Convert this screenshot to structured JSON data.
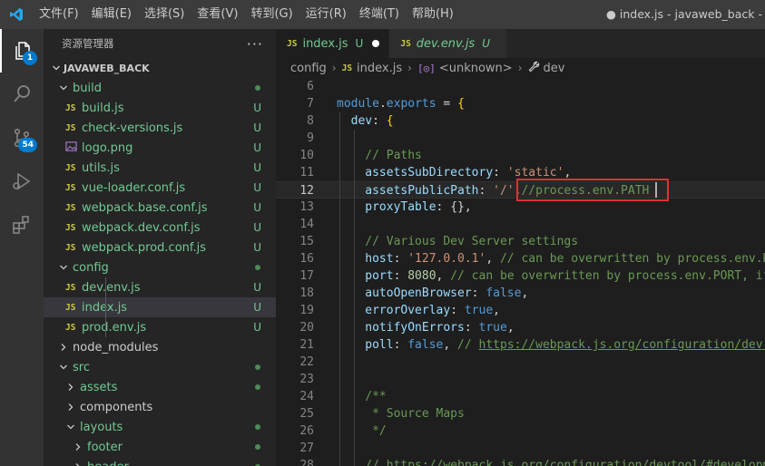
{
  "app": {
    "window_title": "● index.js - javaweb_back - Visual",
    "menu": [
      "文件(F)",
      "编辑(E)",
      "选择(S)",
      "查看(V)",
      "转到(G)",
      "运行(R)",
      "终端(T)",
      "帮助(H)"
    ]
  },
  "activity_bar": {
    "explorer_badge": "1",
    "scm_badge": "54"
  },
  "sidebar": {
    "title": "资源管理器",
    "more": "···",
    "root": "JAVAWEB_BACK",
    "tree": [
      {
        "label": "build",
        "type": "folder",
        "open": true,
        "depth": 1,
        "status": "dot"
      },
      {
        "label": "build.js",
        "type": "js",
        "depth": 2,
        "status": "U"
      },
      {
        "label": "check-versions.js",
        "type": "js",
        "depth": 2,
        "status": "U"
      },
      {
        "label": "logo.png",
        "type": "img",
        "depth": 2,
        "status": "U"
      },
      {
        "label": "utils.js",
        "type": "js",
        "depth": 2,
        "status": "U"
      },
      {
        "label": "vue-loader.conf.js",
        "type": "js",
        "depth": 2,
        "status": "U"
      },
      {
        "label": "webpack.base.conf.js",
        "type": "js",
        "depth": 2,
        "status": "U"
      },
      {
        "label": "webpack.dev.conf.js",
        "type": "js",
        "depth": 2,
        "status": "U"
      },
      {
        "label": "webpack.prod.conf.js",
        "type": "js",
        "depth": 2,
        "status": "U"
      },
      {
        "label": "config",
        "type": "folder",
        "open": true,
        "depth": 1,
        "status": "dot"
      },
      {
        "label": "dev.env.js",
        "type": "js",
        "depth": 2,
        "status": "U",
        "guide": true
      },
      {
        "label": "index.js",
        "type": "js",
        "depth": 2,
        "status": "U",
        "selected": true,
        "guide": true
      },
      {
        "label": "prod.env.js",
        "type": "js",
        "depth": 2,
        "status": "U",
        "guide": true
      },
      {
        "label": "node_modules",
        "type": "folder",
        "open": false,
        "depth": 1,
        "status": "",
        "plain": true
      },
      {
        "label": "src",
        "type": "folder",
        "open": true,
        "depth": 1,
        "status": "dot"
      },
      {
        "label": "assets",
        "type": "folder",
        "open": false,
        "depth": 2,
        "status": "dot"
      },
      {
        "label": "components",
        "type": "folder",
        "open": false,
        "depth": 2,
        "status": "",
        "plain": true
      },
      {
        "label": "layouts",
        "type": "folder",
        "open": true,
        "depth": 2,
        "status": "dot"
      },
      {
        "label": "footer",
        "type": "folder",
        "open": false,
        "depth": 3,
        "status": "dot"
      },
      {
        "label": "header",
        "type": "folder",
        "open": false,
        "depth": 3,
        "status": "dot"
      }
    ]
  },
  "tabs": [
    {
      "icon": "JS",
      "label": "index.js",
      "flag": "U",
      "modified": true,
      "active": true,
      "italic": false
    },
    {
      "icon": "JS",
      "label": "dev.env.js",
      "flag": "U",
      "modified": false,
      "active": false,
      "italic": true
    }
  ],
  "breadcrumb": {
    "folder": "config",
    "file": "index.js",
    "symbol1": "<unknown>",
    "symbol2": "dev",
    "file_icon": "JS"
  },
  "code": {
    "current_line": 12,
    "lines": [
      {
        "n": "6",
        "indent": 0,
        "tokens": []
      },
      {
        "n": "7",
        "indent": 0,
        "tokens": [
          [
            "kw",
            "module"
          ],
          [
            "p",
            "."
          ],
          [
            "kw",
            "exports"
          ],
          [
            "p",
            " = "
          ],
          [
            "b",
            "{"
          ]
        ]
      },
      {
        "n": "8",
        "indent": 1,
        "tokens": [
          [
            "k",
            "dev"
          ],
          [
            "p",
            ": "
          ],
          [
            "b",
            "{"
          ]
        ]
      },
      {
        "n": "9",
        "indent": 0,
        "tokens": []
      },
      {
        "n": "10",
        "indent": 2,
        "tokens": [
          [
            "c",
            "// Paths"
          ]
        ]
      },
      {
        "n": "11",
        "indent": 2,
        "tokens": [
          [
            "k",
            "assetsSubDirectory"
          ],
          [
            "p",
            ": "
          ],
          [
            "s",
            "'static'"
          ],
          [
            "p",
            ","
          ]
        ]
      },
      {
        "n": "12",
        "indent": 2,
        "tokens": [
          [
            "k",
            "assetsPublicPath"
          ],
          [
            "p",
            ": "
          ],
          [
            "s",
            "'/'"
          ],
          [
            "p",
            ","
          ],
          [
            "c",
            "//process.env.PATH"
          ]
        ]
      },
      {
        "n": "13",
        "indent": 2,
        "tokens": [
          [
            "k",
            "proxyTable"
          ],
          [
            "p",
            ": {},"
          ]
        ]
      },
      {
        "n": "14",
        "indent": 0,
        "tokens": []
      },
      {
        "n": "15",
        "indent": 2,
        "tokens": [
          [
            "c",
            "// Various Dev Server settings"
          ]
        ]
      },
      {
        "n": "16",
        "indent": 2,
        "tokens": [
          [
            "k",
            "host"
          ],
          [
            "p",
            ": "
          ],
          [
            "s",
            "'127.0.0.1'"
          ],
          [
            "p",
            ", "
          ],
          [
            "c",
            "// can be overwritten by process.env.HOST"
          ]
        ]
      },
      {
        "n": "17",
        "indent": 2,
        "tokens": [
          [
            "k",
            "port"
          ],
          [
            "p",
            ": "
          ],
          [
            "n",
            "8080"
          ],
          [
            "p",
            ", "
          ],
          [
            "c",
            "// can be overwritten by process.env.PORT, if port is in use"
          ]
        ]
      },
      {
        "n": "18",
        "indent": 2,
        "tokens": [
          [
            "k",
            "autoOpenBrowser"
          ],
          [
            "p",
            ": "
          ],
          [
            "kw",
            "false"
          ],
          [
            "p",
            ","
          ]
        ]
      },
      {
        "n": "19",
        "indent": 2,
        "tokens": [
          [
            "k",
            "errorOverlay"
          ],
          [
            "p",
            ": "
          ],
          [
            "kw",
            "true"
          ],
          [
            "p",
            ","
          ]
        ]
      },
      {
        "n": "20",
        "indent": 2,
        "tokens": [
          [
            "k",
            "notifyOnErrors"
          ],
          [
            "p",
            ": "
          ],
          [
            "kw",
            "true"
          ],
          [
            "p",
            ","
          ]
        ]
      },
      {
        "n": "21",
        "indent": 2,
        "tokens": [
          [
            "k",
            "poll"
          ],
          [
            "p",
            ": "
          ],
          [
            "kw",
            "false"
          ],
          [
            "p",
            ", "
          ],
          [
            "c",
            "// "
          ],
          [
            "u",
            "https://webpack.js.org/configuration/dev-server/"
          ]
        ]
      },
      {
        "n": "22",
        "indent": 0,
        "tokens": []
      },
      {
        "n": "23",
        "indent": 0,
        "tokens": []
      },
      {
        "n": "24",
        "indent": 2,
        "tokens": [
          [
            "c",
            "/**"
          ]
        ]
      },
      {
        "n": "25",
        "indent": 2,
        "tokens": [
          [
            "c",
            " * Source Maps"
          ]
        ]
      },
      {
        "n": "26",
        "indent": 2,
        "tokens": [
          [
            "c",
            " */"
          ]
        ]
      },
      {
        "n": "27",
        "indent": 0,
        "tokens": []
      },
      {
        "n": "28",
        "indent": 2,
        "tokens": [
          [
            "c",
            "// "
          ],
          [
            "u",
            "https://webpack.js.org/configuration/devtool/#development"
          ]
        ]
      }
    ]
  },
  "colors": {
    "accent": "#007acc",
    "untracked": "#73c991",
    "highlight_box": "#e03131"
  }
}
